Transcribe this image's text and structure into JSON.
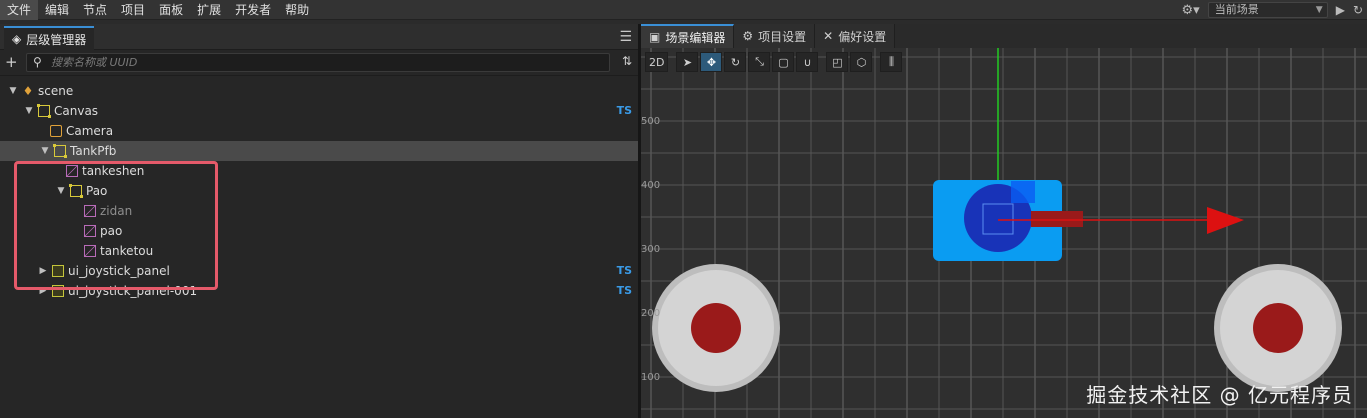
{
  "menu": [
    "文件",
    "编辑",
    "节点",
    "项目",
    "面板",
    "扩展",
    "开发者",
    "帮助"
  ],
  "scene_select": "当前场景",
  "hierarchy": {
    "title": "层级管理器",
    "search_placeholder": "搜索名称或 UUID",
    "nodes": [
      {
        "label": "scene",
        "ts": ""
      },
      {
        "label": "Canvas",
        "ts": "TS"
      },
      {
        "label": "Camera",
        "ts": ""
      },
      {
        "label": "TankPfb",
        "ts": ""
      },
      {
        "label": "tankeshen",
        "ts": ""
      },
      {
        "label": "Pao",
        "ts": ""
      },
      {
        "label": "zidan",
        "ts": ""
      },
      {
        "label": "pao",
        "ts": ""
      },
      {
        "label": "tanketou",
        "ts": ""
      },
      {
        "label": "ui_joystick_panel",
        "ts": "TS"
      },
      {
        "label": "ui_joystick_panel-001",
        "ts": "TS"
      }
    ]
  },
  "tabs": [
    {
      "label": "场景编辑器",
      "icon": "scene-editor-icon"
    },
    {
      "label": "项目设置",
      "icon": "gear-icon"
    },
    {
      "label": "偏好设置",
      "icon": "wrench-icon"
    }
  ],
  "toolbar": {
    "mode_2d": "2D"
  },
  "axis_labels": [
    "500",
    "400",
    "300",
    "200",
    "100"
  ],
  "watermark": "掘金技术社区 @ 亿元程序员",
  "colors": {
    "accent": "#3a8fd6",
    "ts_badge": "#3a9ae6",
    "highlight": "#e55a6a",
    "tank_body": "#0a9cf2",
    "tank_turret": "#1833b8",
    "joystick_outer": "#d4d4d4",
    "joystick_inner": "#9a1a1a"
  }
}
